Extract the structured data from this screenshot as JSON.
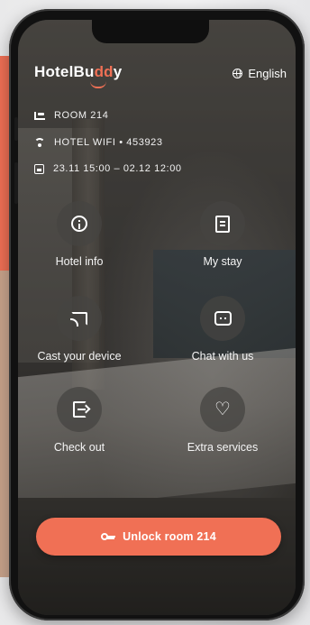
{
  "app": {
    "logo_text_main": "HotelBu",
    "logo_text_accent": "dd",
    "logo_text_end": "y",
    "language": "English"
  },
  "info": [
    {
      "icon": "bed-icon",
      "text": "ROOM 214"
    },
    {
      "icon": "wifi-icon",
      "text": "HOTEL WIFI • 453923"
    },
    {
      "icon": "calendar-icon",
      "text": "23.11 15:00 – 02.12 12:00"
    }
  ],
  "tiles": [
    {
      "icon": "info-icon",
      "label": "Hotel info"
    },
    {
      "icon": "document-icon",
      "label": "My stay"
    },
    {
      "icon": "cast-icon",
      "label": "Cast your device"
    },
    {
      "icon": "chat-icon",
      "label": "Chat with us"
    },
    {
      "icon": "exit-icon",
      "label": "Check out"
    },
    {
      "icon": "heart-icon",
      "label": "Extra services"
    }
  ],
  "unlock_button": {
    "icon": "key-icon",
    "label": "Unlock room 214"
  },
  "colors": {
    "accent": "#f07055",
    "overlay": "#3f3c3a"
  }
}
